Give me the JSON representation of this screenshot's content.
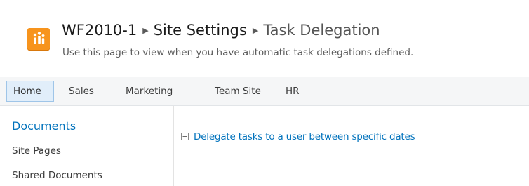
{
  "header": {
    "breadcrumb": {
      "site": "WF2010-1",
      "section": "Site Settings",
      "current": "Task Delegation",
      "separator": "▶"
    },
    "description": "Use this page to view when you have automatic task delegations defined."
  },
  "topnav": {
    "items": [
      {
        "label": "Home",
        "selected": true
      },
      {
        "label": "Sales"
      },
      {
        "label": "Marketing"
      },
      {
        "label": "Team Site"
      },
      {
        "label": "HR"
      }
    ]
  },
  "quicklaunch": {
    "heading": "Documents",
    "items": [
      {
        "label": "Site Pages"
      },
      {
        "label": "Shared Documents"
      }
    ]
  },
  "content": {
    "link": "Delegate tasks to a user between specific dates"
  },
  "colors": {
    "logo": "#f7941d",
    "link": "#0072bc",
    "nav_selected_bg": "#e1eefa",
    "nav_selected_border": "#9fc5e8"
  },
  "icons": {
    "logo": "site-logo-people-icon",
    "bullet": "list-bullet-icon",
    "separator": "breadcrumb-separator-icon"
  }
}
